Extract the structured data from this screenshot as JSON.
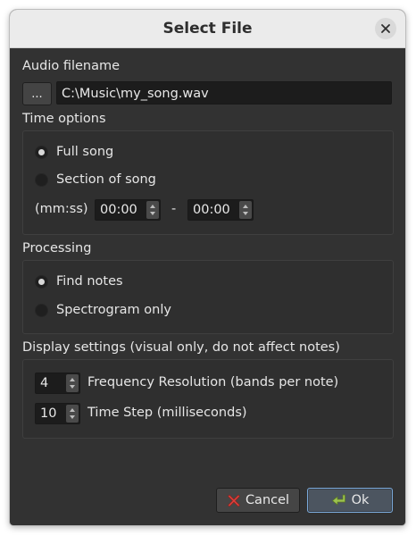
{
  "dialog": {
    "title": "Select File"
  },
  "audio": {
    "section_label": "Audio filename",
    "browse_label": "...",
    "filename": "C:\\Music\\my_song.wav"
  },
  "time_options": {
    "section_label": "Time options",
    "full_song_label": "Full song",
    "section_of_song_label": "Section of song",
    "selected": "Full song",
    "range_label": "(mm:ss)",
    "start": "00:00",
    "separator": "-",
    "end": "00:00"
  },
  "processing": {
    "section_label": "Processing",
    "find_notes_label": "Find notes",
    "spectrogram_only_label": "Spectrogram only",
    "selected": "Find notes"
  },
  "display": {
    "section_label": "Display settings (visual only, do not affect notes)",
    "freq_resolution_value": "4",
    "freq_resolution_label": "Frequency Resolution (bands per note)",
    "time_step_value": "10",
    "time_step_label": "Time Step (milliseconds)"
  },
  "buttons": {
    "cancel_label": "Cancel",
    "ok_label": "Ok"
  },
  "icons": {
    "close": "close-icon",
    "cancel": "red-x-icon",
    "ok": "green-enter-arrow-icon"
  },
  "colors": {
    "dialog_bg": "#323232",
    "ok_border": "#7aa8d8",
    "cancel_icon": "#d9413c",
    "ok_icon": "#9dc34f"
  }
}
